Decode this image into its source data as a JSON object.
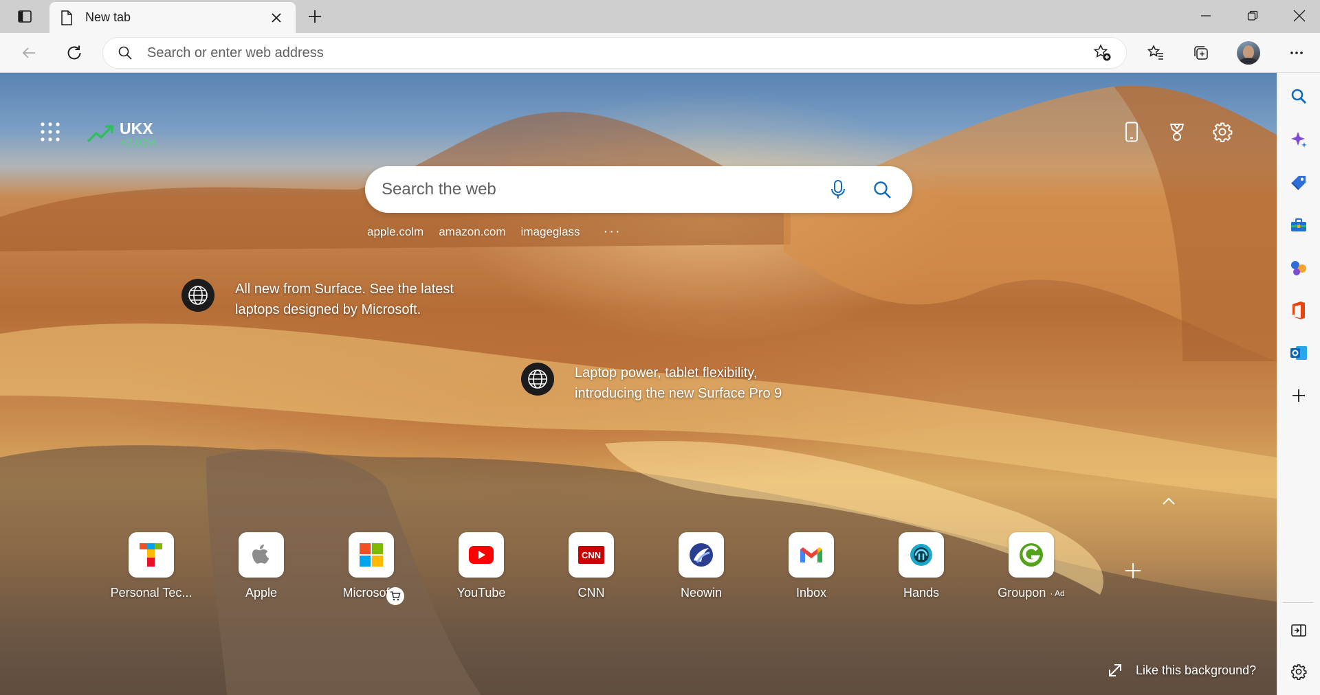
{
  "tab": {
    "title": "New tab"
  },
  "address_bar": {
    "placeholder": "Search or enter web address"
  },
  "stock": {
    "ticker": "UKX",
    "change": "+2.03%"
  },
  "web_search": {
    "placeholder": "Search the web"
  },
  "quick_links": [
    "apple.colm",
    "amazon.com",
    "imageglass"
  ],
  "quick_links_more": "···",
  "promos": [
    {
      "line1": "All new from Surface. See the latest",
      "line2": "laptops designed by Microsoft."
    },
    {
      "line1": "Laptop power, tablet flexibility,",
      "line2": "introducing the new Surface Pro 9"
    }
  ],
  "top_sites": [
    {
      "label": "Personal Tec...",
      "icon": "personal-tech-icon"
    },
    {
      "label": "Apple",
      "icon": "apple-icon"
    },
    {
      "label": "Microsof...",
      "icon": "microsoft-icon"
    },
    {
      "label": "YouTube",
      "icon": "youtube-icon"
    },
    {
      "label": "CNN",
      "icon": "cnn-icon"
    },
    {
      "label": "Neowin",
      "icon": "neowin-icon"
    },
    {
      "label": "Inbox",
      "icon": "gmail-icon"
    },
    {
      "label": "Hands",
      "icon": "hands-icon"
    },
    {
      "label": "Groupon",
      "icon": "groupon-icon",
      "ad": "· Ad"
    }
  ],
  "background_prompt": "Like this background?",
  "colors": {
    "stock_up": "#59d47a",
    "accent_blue": "#0f6cbd",
    "youtube_red": "#ff0000",
    "cnn_red": "#cc0000",
    "groupon_green": "#53a318"
  }
}
